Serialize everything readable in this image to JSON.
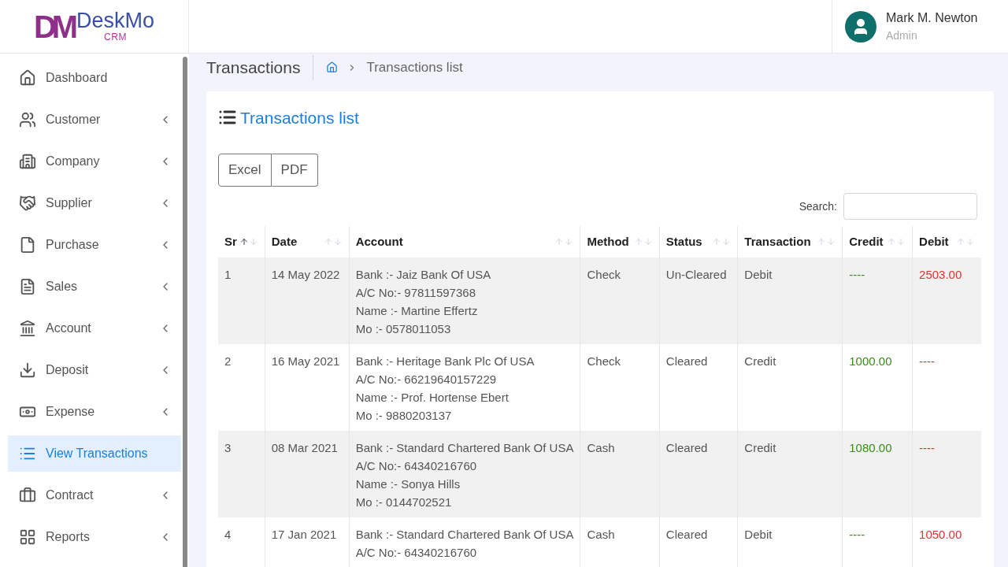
{
  "brand": {
    "monogram": "DM",
    "name": "DeskMo",
    "sub": "CRM"
  },
  "user": {
    "name": "Mark M. Newton",
    "role": "Admin"
  },
  "sidebar": {
    "items": [
      {
        "label": "Dashboard",
        "submenu": false,
        "selected": false
      },
      {
        "label": "Customer",
        "submenu": true,
        "selected": false
      },
      {
        "label": "Company",
        "submenu": true,
        "selected": false
      },
      {
        "label": "Supplier",
        "submenu": true,
        "selected": false
      },
      {
        "label": "Purchase",
        "submenu": true,
        "selected": false
      },
      {
        "label": "Sales",
        "submenu": true,
        "selected": false
      },
      {
        "label": "Account",
        "submenu": true,
        "selected": false
      },
      {
        "label": "Deposit",
        "submenu": true,
        "selected": false
      },
      {
        "label": "Expense",
        "submenu": true,
        "selected": false
      },
      {
        "label": "View Transactions",
        "submenu": false,
        "selected": true
      },
      {
        "label": "Contract",
        "submenu": true,
        "selected": false
      },
      {
        "label": "Reports",
        "submenu": true,
        "selected": false
      }
    ]
  },
  "page": {
    "title": "Transactions",
    "breadcrumb": [
      "Transactions list"
    ]
  },
  "card": {
    "title": "Transactions list",
    "export_buttons": [
      "Excel",
      "PDF"
    ],
    "search": {
      "label": "Search:"
    }
  },
  "table": {
    "columns": [
      {
        "label": "Sr",
        "sorted": true
      },
      {
        "label": "Date",
        "sorted": false
      },
      {
        "label": "Account",
        "sorted": false
      },
      {
        "label": "Method",
        "sorted": false
      },
      {
        "label": "Status",
        "sorted": false
      },
      {
        "label": "Transaction",
        "sorted": false
      },
      {
        "label": "Credit",
        "sorted": false
      },
      {
        "label": "Debit",
        "sorted": false
      }
    ],
    "rows": [
      {
        "sr": "1",
        "date": "14 May 2022",
        "account": [
          "Bank :- Jaiz Bank Of USA",
          "A/C No:- 97811597368",
          "Name :- Martine Effertz",
          "Mo :- 0578011053"
        ],
        "method": "Check",
        "status": "Un-Cleared",
        "transaction": "Debit",
        "credit": "----",
        "debit": "2503.00"
      },
      {
        "sr": "2",
        "date": "16 May 2021",
        "account": [
          "Bank :- Heritage Bank Plc Of USA",
          "A/C No:- 66219640157229",
          "Name :- Prof. Hortense Ebert",
          "Mo :- 9880203137"
        ],
        "method": "Check",
        "status": "Cleared",
        "transaction": "Credit",
        "credit": "1000.00",
        "debit": "----"
      },
      {
        "sr": "3",
        "date": "08 Mar 2021",
        "account": [
          "Bank :- Standard Chartered Bank Of USA",
          "A/C No:- 64340216760",
          "Name :- Sonya Hills",
          "Mo :- 0144702521"
        ],
        "method": "Cash",
        "status": "Cleared",
        "transaction": "Credit",
        "credit": "1080.00",
        "debit": "----"
      },
      {
        "sr": "4",
        "date": "17 Jan 2021",
        "account": [
          "Bank :- Standard Chartered Bank Of USA",
          "A/C No:- 64340216760"
        ],
        "method": "Cash",
        "status": "Cleared",
        "transaction": "Debit",
        "credit": "----",
        "debit": "1050.00"
      }
    ]
  }
}
